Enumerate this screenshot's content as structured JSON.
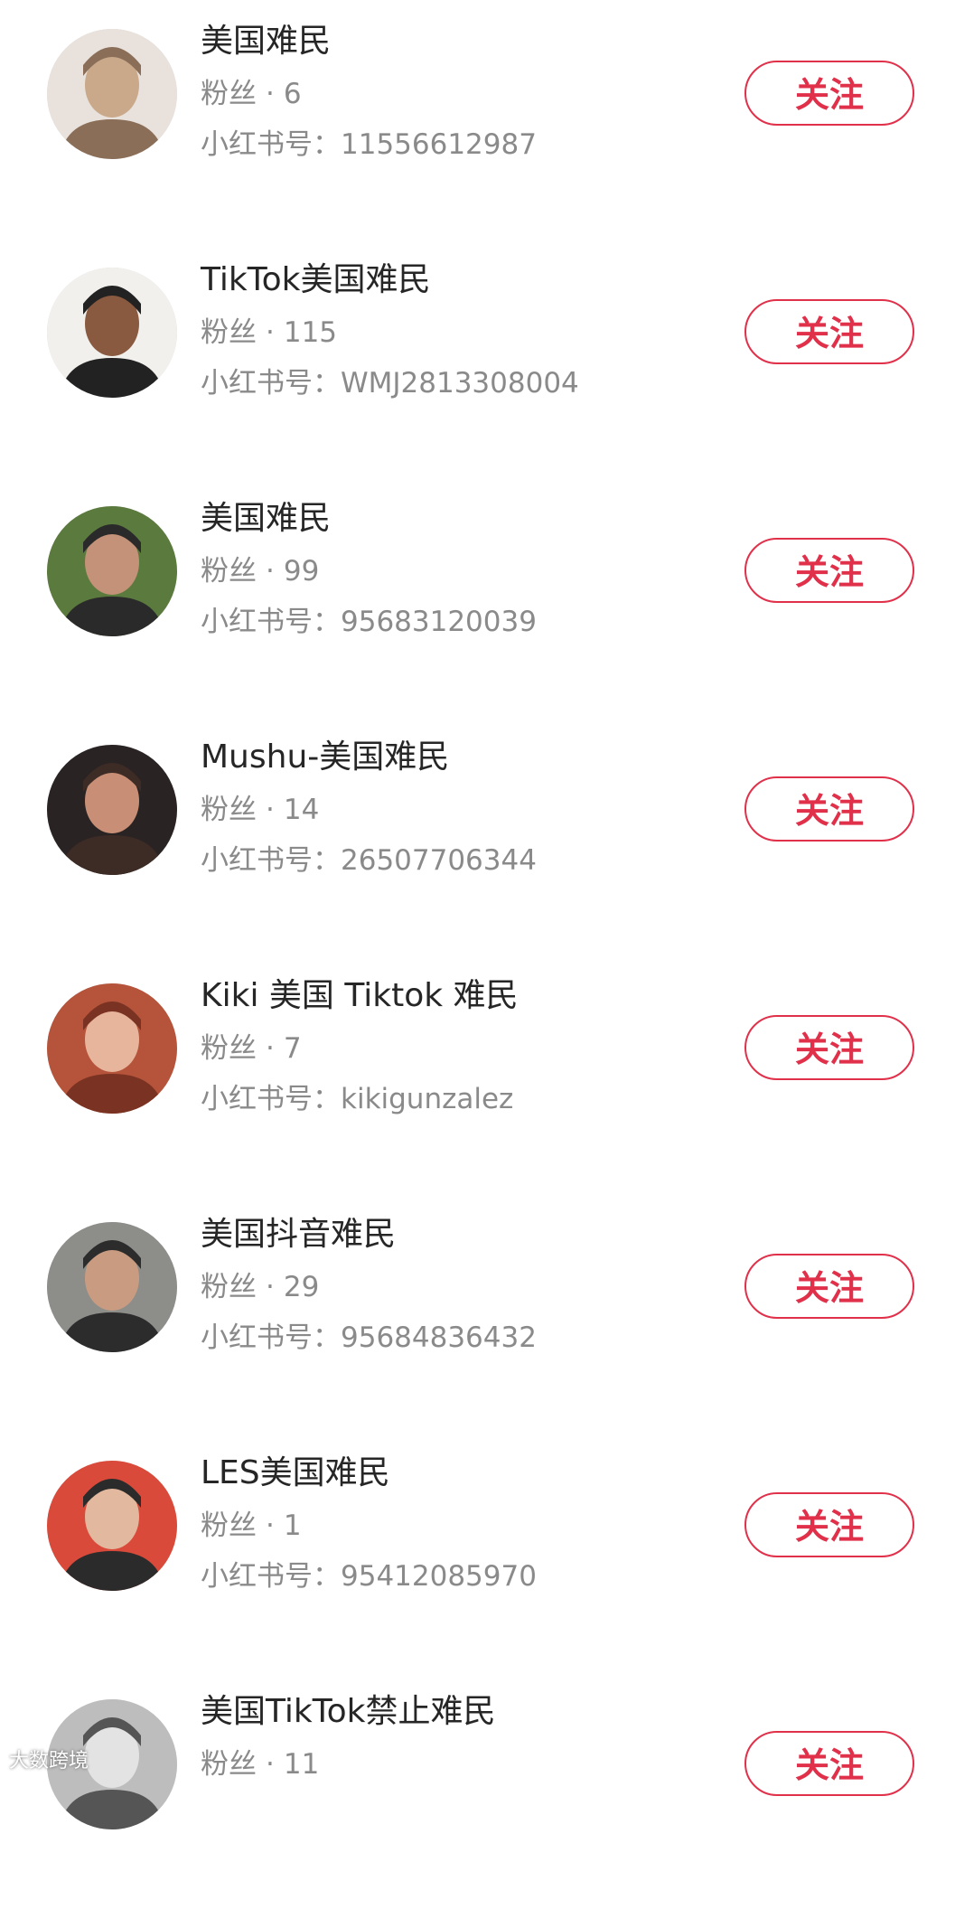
{
  "users": [
    {
      "name": "美国难民",
      "fans_label": "粉丝",
      "fans": "6",
      "id_label": "小红书号：",
      "id": "11556612987",
      "follow": "关注",
      "avatar_colors": [
        "#e9e2dc",
        "#c9a98a",
        "#8a6e58"
      ]
    },
    {
      "name": "TikTok美国难民",
      "fans_label": "粉丝",
      "fans": "115",
      "id_label": "小红书号：",
      "id": "WMJ2813308004",
      "follow": "关注",
      "avatar_colors": [
        "#f2f0ec",
        "#8a5a40",
        "#222222"
      ]
    },
    {
      "name": "美国难民",
      "fans_label": "粉丝",
      "fans": "99",
      "id_label": "小红书号：",
      "id": "95683120039",
      "follow": "关注",
      "avatar_colors": [
        "#5b7a3e",
        "#c49278",
        "#2a2a2a"
      ]
    },
    {
      "name": "Mushu-美国难民",
      "fans_label": "粉丝",
      "fans": "14",
      "id_label": "小红书号：",
      "id": "26507706344",
      "follow": "关注",
      "avatar_colors": [
        "#2a2323",
        "#c88f76",
        "#3d2b25"
      ]
    },
    {
      "name": "Kiki 美国 Tiktok 难民",
      "fans_label": "粉丝",
      "fans": "7",
      "id_label": "小红书号：",
      "id": "kikigunzalez",
      "follow": "关注",
      "avatar_colors": [
        "#b5543a",
        "#e7b49c",
        "#7a3222"
      ]
    },
    {
      "name": "美国抖音难民",
      "fans_label": "粉丝",
      "fans": "29",
      "id_label": "小红书号：",
      "id": "95684836432",
      "follow": "关注",
      "avatar_colors": [
        "#8d8d8a",
        "#c99c82",
        "#2c2c2c"
      ]
    },
    {
      "name": "LES美国难民",
      "fans_label": "粉丝",
      "fans": "1",
      "id_label": "小红书号：",
      "id": "95412085970",
      "follow": "关注",
      "avatar_colors": [
        "#d94a3a",
        "#e2b89e",
        "#2b2b2b"
      ]
    },
    {
      "name": "美国TikTok禁止难民",
      "fans_label": "粉丝",
      "fans": "11",
      "id_label": "",
      "id": "",
      "follow": "关注",
      "avatar_colors": [
        "#bdbdbd",
        "#e3e3e3",
        "#555555"
      ]
    }
  ],
  "fans_separator": "·",
  "watermark": "大数跨境"
}
